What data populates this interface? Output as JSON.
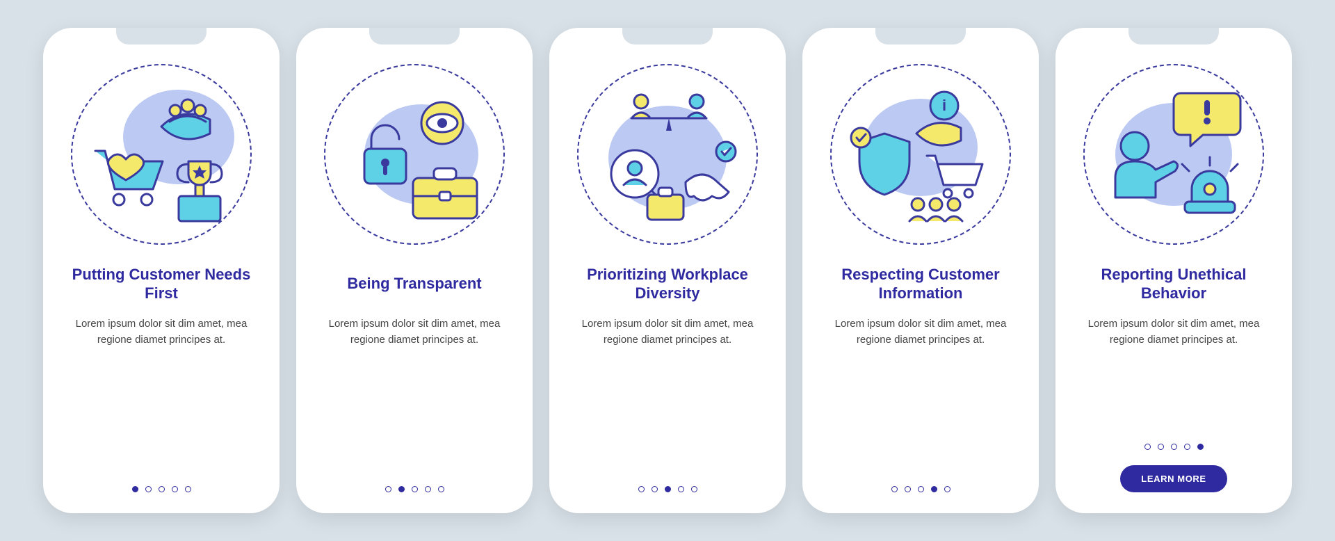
{
  "colors": {
    "accent": "#2f2aa0",
    "bg": "#d8e1e8",
    "cyan": "#5ed1e6",
    "yellow": "#f5e96b",
    "lilac": "#bcc9f2"
  },
  "cards": [
    {
      "icon": "customer-needs-icon",
      "title": "Putting Customer Needs First",
      "desc": "Lorem ipsum dolor sit dim amet, mea regione diamet principes at.",
      "active_dot": 0,
      "has_button": false
    },
    {
      "icon": "transparency-icon",
      "title": "Being Transparent",
      "desc": "Lorem ipsum dolor sit dim amet, mea regione diamet principes at.",
      "active_dot": 1,
      "has_button": false
    },
    {
      "icon": "diversity-icon",
      "title": "Prioritizing Workplace Diversity",
      "desc": "Lorem ipsum dolor sit dim amet, mea regione diamet principes at.",
      "active_dot": 2,
      "has_button": false
    },
    {
      "icon": "customer-info-icon",
      "title": "Respecting Customer Information",
      "desc": "Lorem ipsum dolor sit dim amet, mea regione diamet principes at.",
      "active_dot": 3,
      "has_button": false
    },
    {
      "icon": "reporting-icon",
      "title": "Reporting Unethical Behavior",
      "desc": "Lorem ipsum dolor sit dim amet, mea regione diamet principes at.",
      "active_dot": 4,
      "has_button": true
    }
  ],
  "dot_count": 5,
  "button_label": "LEARN MORE"
}
